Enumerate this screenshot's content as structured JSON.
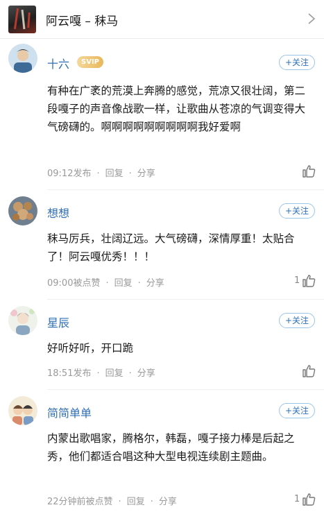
{
  "header": {
    "title": "阿云嘎 – 秣马"
  },
  "comments": [
    {
      "username": "十六",
      "badge": "SVIP",
      "follow_label": "+关注",
      "text": "有种在广袤的荒漠上奔腾的感觉，荒凉又很壮阔，第二段嘎子的声音像战歌一样，让歌曲从苍凉的气调变得大气磅礴的。啊啊啊啊啊啊啊啊啊我好爱啊",
      "time": "09:12发布",
      "reply": "回复",
      "share": "分享",
      "likes": ""
    },
    {
      "username": "想想",
      "follow_label": "+关注",
      "text": "秣马厉兵，壮阔辽远。大气磅礴，深情厚重！太贴合了！阿云嘎优秀！！！",
      "time": "09:00被点赞",
      "reply": "回复",
      "share": "分享",
      "likes": "1"
    },
    {
      "username": "星辰",
      "follow_label": "+关注",
      "text": "好听好听，开口跪",
      "time": "18:51发布",
      "reply": "回复",
      "share": "分享",
      "likes": ""
    },
    {
      "username": "简简单单",
      "follow_label": "+关注",
      "text": "内蒙出歌唱家，腾格尔，韩磊，嘎子接力棒是后起之秀，他们都适合唱这种大型电视连续剧主题曲。",
      "time": "22分钟前被点赞",
      "reply": "回复",
      "share": "分享",
      "likes": "1"
    }
  ],
  "colors": {
    "username": "#2f6fb5",
    "meta": "#9a9a9a",
    "svip": "#e8b85a"
  },
  "icons": {
    "chevron": "chevron-right-icon",
    "like": "thumbs-up-icon"
  }
}
